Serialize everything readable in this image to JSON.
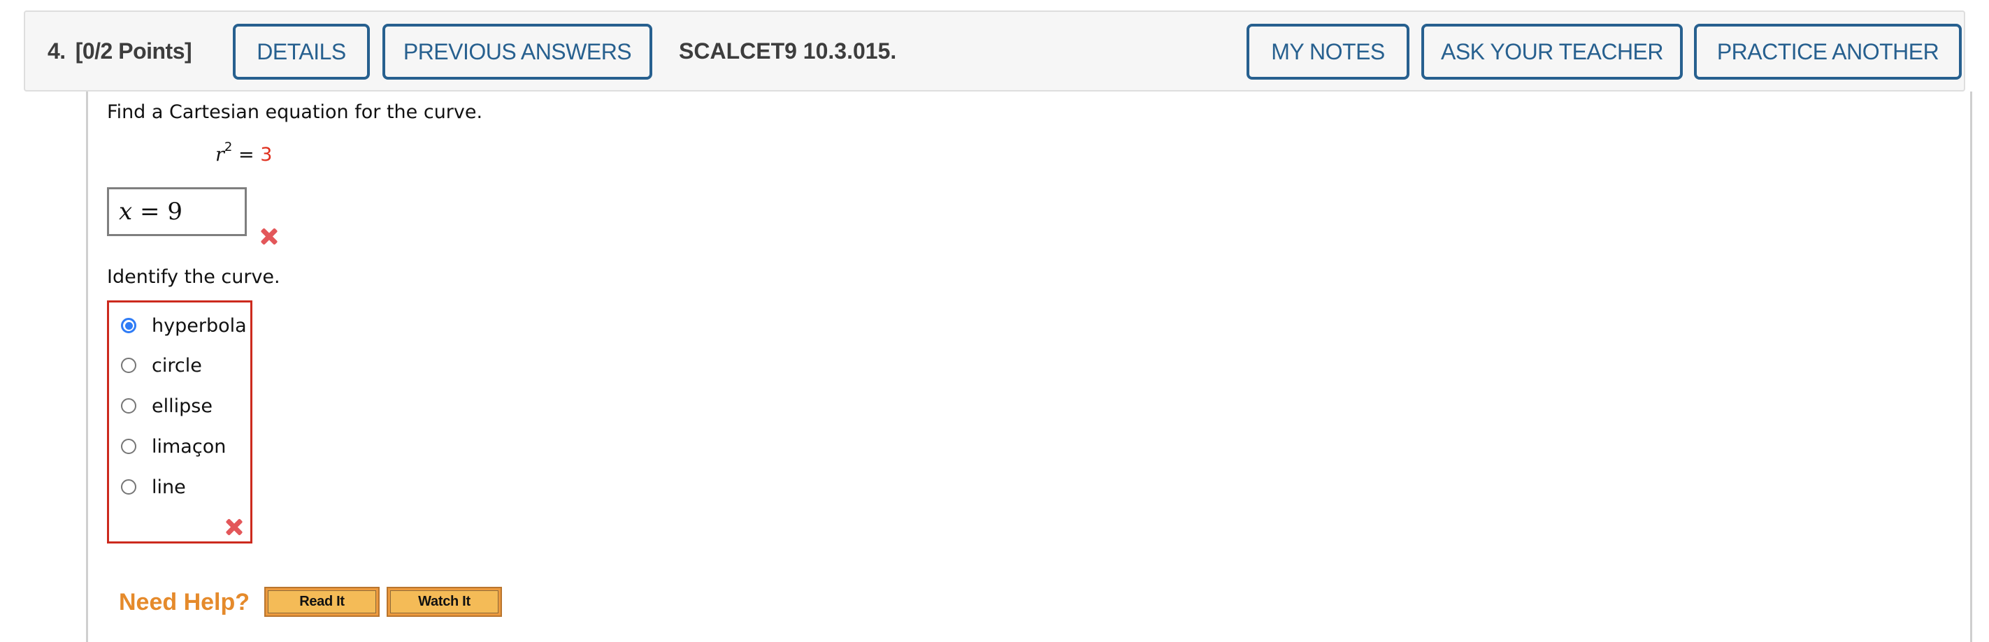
{
  "question": {
    "number": "4.",
    "points": "[0/2 Points]",
    "code": "SCALCET9 10.3.015."
  },
  "header_buttons": {
    "details": "DETAILS",
    "previous_answers": "PREVIOUS ANSWERS",
    "my_notes": "MY NOTES",
    "ask_teacher": "ASK YOUR TEACHER",
    "practice_another": "PRACTICE ANOTHER"
  },
  "colors": {
    "button_blue": "#27608f",
    "error_red": "#cc2a1e",
    "accent_orange": "#e58a2b",
    "radio_selected": "#2f7cf6"
  },
  "part1": {
    "prompt": "Find a Cartesian equation for the curve.",
    "equation": {
      "variable": "r",
      "exponent": "2",
      "equals": "=",
      "value": "3"
    },
    "answer": {
      "var": "x",
      "op": "=",
      "value": "9"
    },
    "status": "incorrect",
    "status_icon": "red-x-icon"
  },
  "part2": {
    "prompt": "Identify the curve.",
    "options": [
      {
        "label": "hyperbola",
        "selected": true
      },
      {
        "label": "circle",
        "selected": false
      },
      {
        "label": "ellipse",
        "selected": false
      },
      {
        "label": "limaçon",
        "selected": false
      },
      {
        "label": "line",
        "selected": false
      }
    ],
    "status": "incorrect",
    "status_icon": "red-x-icon"
  },
  "help": {
    "label": "Need Help?",
    "read_it": "Read It",
    "watch_it": "Watch It"
  }
}
